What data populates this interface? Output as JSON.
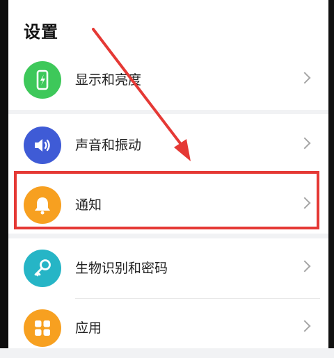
{
  "page": {
    "title": "设置"
  },
  "settings": [
    {
      "label": "显示和亮度",
      "icon": "phone-brightness-icon",
      "color": "#3ec85a"
    },
    {
      "label": "声音和振动",
      "icon": "speaker-icon",
      "color": "#3f5bd6"
    },
    {
      "label": "通知",
      "icon": "bell-icon",
      "color": "#f7a020"
    },
    {
      "label": "生物识别和密码",
      "icon": "key-icon",
      "color": "#26b5c6"
    },
    {
      "label": "应用",
      "icon": "grid-icon",
      "color": "#f7a020"
    }
  ],
  "annotation": {
    "color": "#e53935"
  }
}
